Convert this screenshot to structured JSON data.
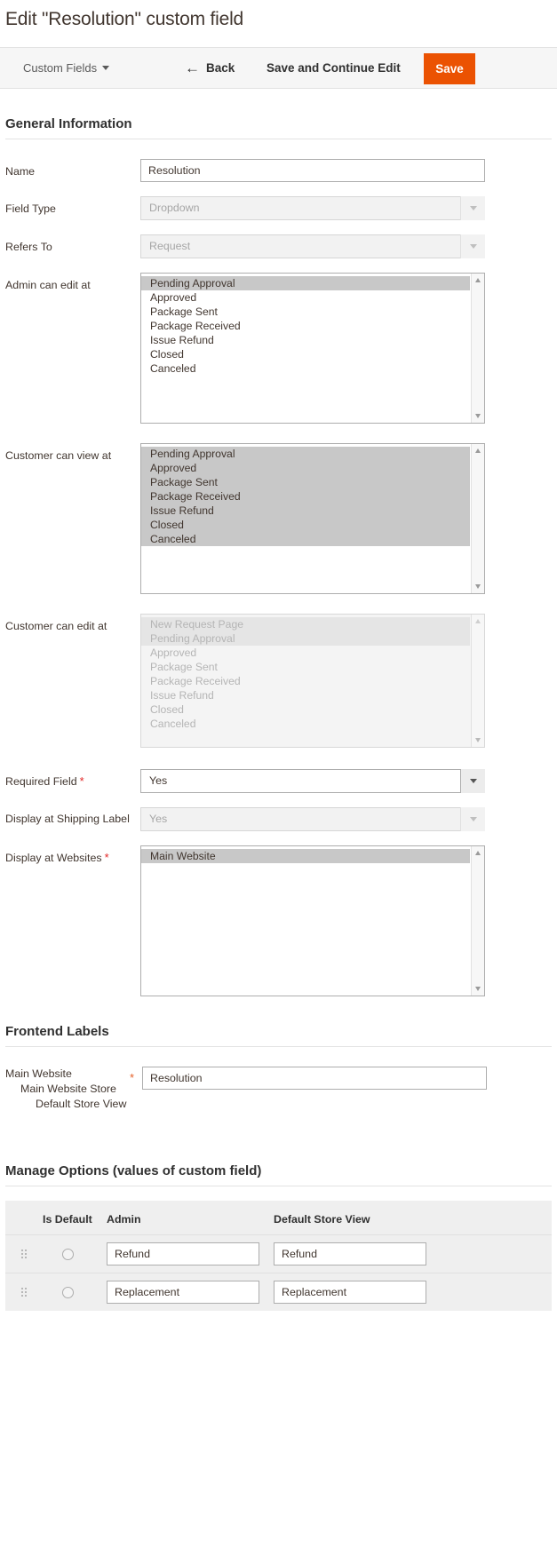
{
  "page": {
    "title": "Edit \"Resolution\" custom field"
  },
  "toolbar": {
    "switcher_label": "Custom Fields",
    "back_label": "Back",
    "back_arrow": "←",
    "save_continue_label": "Save and Continue Edit",
    "save_label": "Save",
    "save_color": "#eb5202"
  },
  "general": {
    "legend": "General Information",
    "name": {
      "label": "Name",
      "value": "Resolution"
    },
    "field_type": {
      "label": "Field Type",
      "value": "Dropdown",
      "disabled": true
    },
    "refers_to": {
      "label": "Refers To",
      "value": "Request",
      "disabled": true
    },
    "admin_can_edit_at": {
      "label": "Admin can edit at",
      "options": [
        {
          "label": "Pending Approval",
          "selected": true
        },
        {
          "label": "Approved",
          "selected": false
        },
        {
          "label": "Package Sent",
          "selected": false
        },
        {
          "label": "Package Received",
          "selected": false
        },
        {
          "label": "Issue Refund",
          "selected": false
        },
        {
          "label": "Closed",
          "selected": false
        },
        {
          "label": "Canceled",
          "selected": false
        }
      ]
    },
    "customer_can_view_at": {
      "label": "Customer can view at",
      "options": [
        {
          "label": "Pending Approval",
          "selected": true
        },
        {
          "label": "Approved",
          "selected": true
        },
        {
          "label": "Package Sent",
          "selected": true
        },
        {
          "label": "Package Received",
          "selected": true
        },
        {
          "label": "Issue Refund",
          "selected": true
        },
        {
          "label": "Closed",
          "selected": true
        },
        {
          "label": "Canceled",
          "selected": true
        }
      ]
    },
    "customer_can_edit_at": {
      "label": "Customer can edit at",
      "disabled": true,
      "options": [
        {
          "label": "New Request Page",
          "selected": true
        },
        {
          "label": "Pending Approval",
          "selected": true
        },
        {
          "label": "Approved",
          "selected": false
        },
        {
          "label": "Package Sent",
          "selected": false
        },
        {
          "label": "Package Received",
          "selected": false
        },
        {
          "label": "Issue Refund",
          "selected": false
        },
        {
          "label": "Closed",
          "selected": false
        },
        {
          "label": "Canceled",
          "selected": false
        }
      ]
    },
    "required_field": {
      "label": "Required Field",
      "value": "Yes",
      "required": true
    },
    "display_at_shipping_label": {
      "label": "Display at Shipping Label",
      "value": "Yes",
      "disabled": true
    },
    "display_at_websites": {
      "label": "Display at Websites",
      "required": true,
      "options": [
        {
          "label": "Main Website",
          "selected": true
        }
      ]
    }
  },
  "frontend_labels": {
    "legend": "Frontend Labels",
    "scope": {
      "website": "Main Website",
      "store": "Main Website Store",
      "store_view": "Default Store View"
    },
    "value": "Resolution",
    "required_mark": "*"
  },
  "manage_options": {
    "legend": "Manage Options (values of custom field)",
    "columns": [
      "Is Default",
      "Admin",
      "Default Store View"
    ],
    "rows": [
      {
        "is_default": false,
        "admin": "Refund",
        "default_store_view": "Refund"
      },
      {
        "is_default": false,
        "admin": "Replacement",
        "default_store_view": "Replacement"
      }
    ]
  }
}
